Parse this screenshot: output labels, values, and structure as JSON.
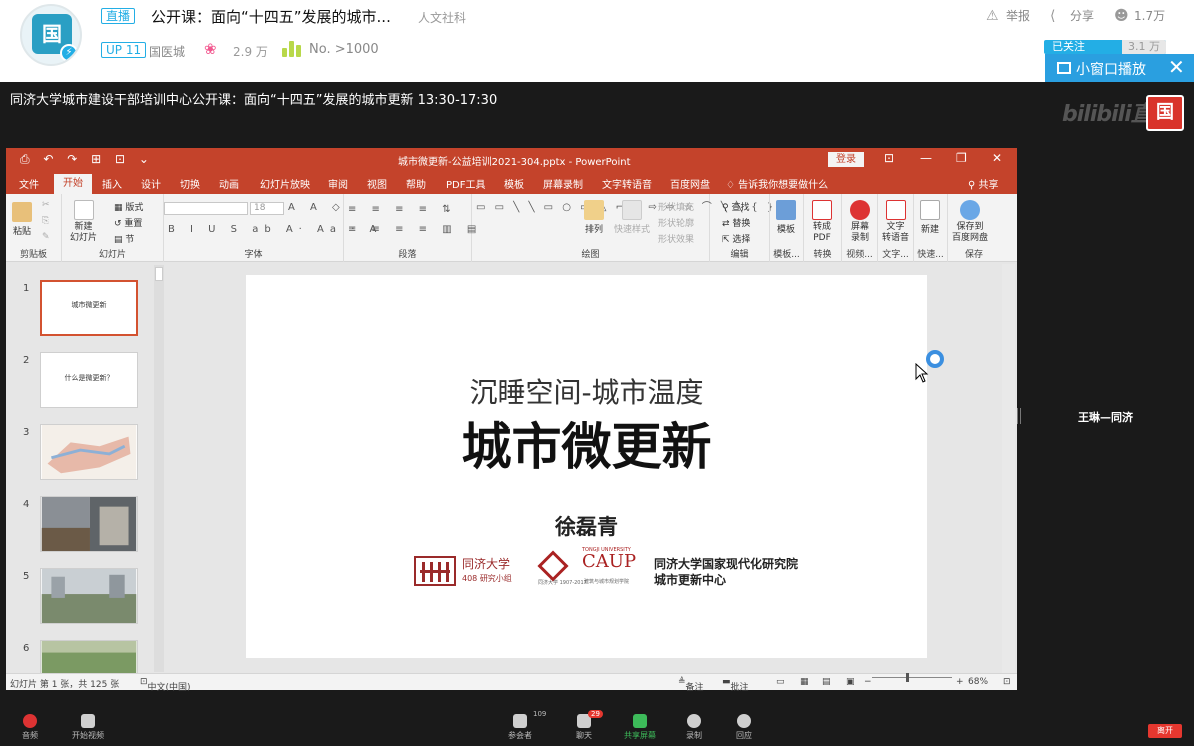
{
  "header": {
    "live_tag": "直播",
    "title": "公开课：面向“十四五”发展的城市...",
    "channel": "人文社科",
    "up_tag": "UP 11",
    "area": "国医城",
    "popularity": "2.9 万",
    "rank": "No. >1000",
    "report": "举报",
    "share": "分享",
    "viewers": "1.7万",
    "follow_label": "已关注",
    "follow_count": "3.1 万",
    "mini_window": "小窗口播放"
  },
  "video": {
    "meeting_title": "同济大学城市建设干部培训中心公开课：面向“十四五”发展的城市更新  13:30-17:30",
    "watermark": "bilibili直",
    "participant_name": "王琳—同济"
  },
  "ppt": {
    "quick_access": "⎙ ↶ ↷ ⊞ ⊡ ⌄",
    "file_title": "城市微更新-公益培训2021-304.pptx  -  PowerPoint",
    "login": "登录",
    "tabs": [
      "文件",
      "开始",
      "插入",
      "设计",
      "切换",
      "动画",
      "幻灯片放映",
      "审阅",
      "视图",
      "帮助",
      "PDF工具",
      "模板",
      "屏幕录制",
      "文字转语音",
      "百度网盘"
    ],
    "tell_me": "告诉我你想要做什么",
    "share": "共享",
    "ribbon": {
      "paste": "粘贴",
      "clipboard": "剪贴板",
      "new_slide": "新建\n幻灯片",
      "layout": "版式",
      "reset": "重置",
      "section": "节",
      "slides_group": "幻灯片",
      "font_size": "18",
      "font_group": "字体",
      "paragraph_group": "段落",
      "arrange": "排列",
      "quick_styles": "快速样式",
      "shape_fill": "形状填充",
      "shape_outline": "形状轮廓",
      "shape_effects": "形状效果",
      "drawing_group": "绘图",
      "find": "查找",
      "replace": "替换",
      "select": "选择",
      "editing_group": "编辑",
      "template": "模板",
      "template_group": "模板...",
      "to_pdf": "转成\nPDF",
      "convert_group": "转换",
      "screen_record": "屏幕\n录制",
      "video_group": "视频...",
      "tts": "文字\n转语音",
      "tts_group": "文字...",
      "new": "新建",
      "quick_group": "快速...",
      "save_baidu": "保存到\n百度网盘",
      "save_group": "保存"
    },
    "thumb_numbers": [
      "1",
      "2",
      "3",
      "4",
      "5",
      "6"
    ],
    "thumb1_title": "城市微更新",
    "thumb2_title": "什么是微更新？",
    "slide": {
      "subtitle": "沉睡空间-城市温度",
      "title": "城市微更新",
      "author": "徐磊青",
      "logo1_name": "同济大学",
      "logo1_sub": "408 研究小组",
      "logo2_sub": "同济大学 1907-2017",
      "logo3_top": "TONGJI UNIVERSITY",
      "logo3": "CAUP",
      "logo3_sub": "建筑与城市规划学院",
      "org_line1": "同济大学国家现代化研究院",
      "org_line2": "城市更新中心"
    },
    "status": {
      "slide_count": "幻灯片 第 1 张，共 125 张",
      "language": "中文(中国)",
      "notes": "备注",
      "comments": "批注",
      "zoom": "68%"
    }
  },
  "toolbar": {
    "mute": "音频",
    "video": "开始视频",
    "participants": "参会者",
    "participants_count": "109",
    "chat": "聊天",
    "chat_badge": "29",
    "share": "共享屏幕",
    "record": "录制",
    "reactions": "回应",
    "leave": "离开"
  },
  "colors": {
    "bili_blue": "#23aee5",
    "ppt_red": "#c4432b",
    "slide_logo_red": "#9a2a2a"
  }
}
